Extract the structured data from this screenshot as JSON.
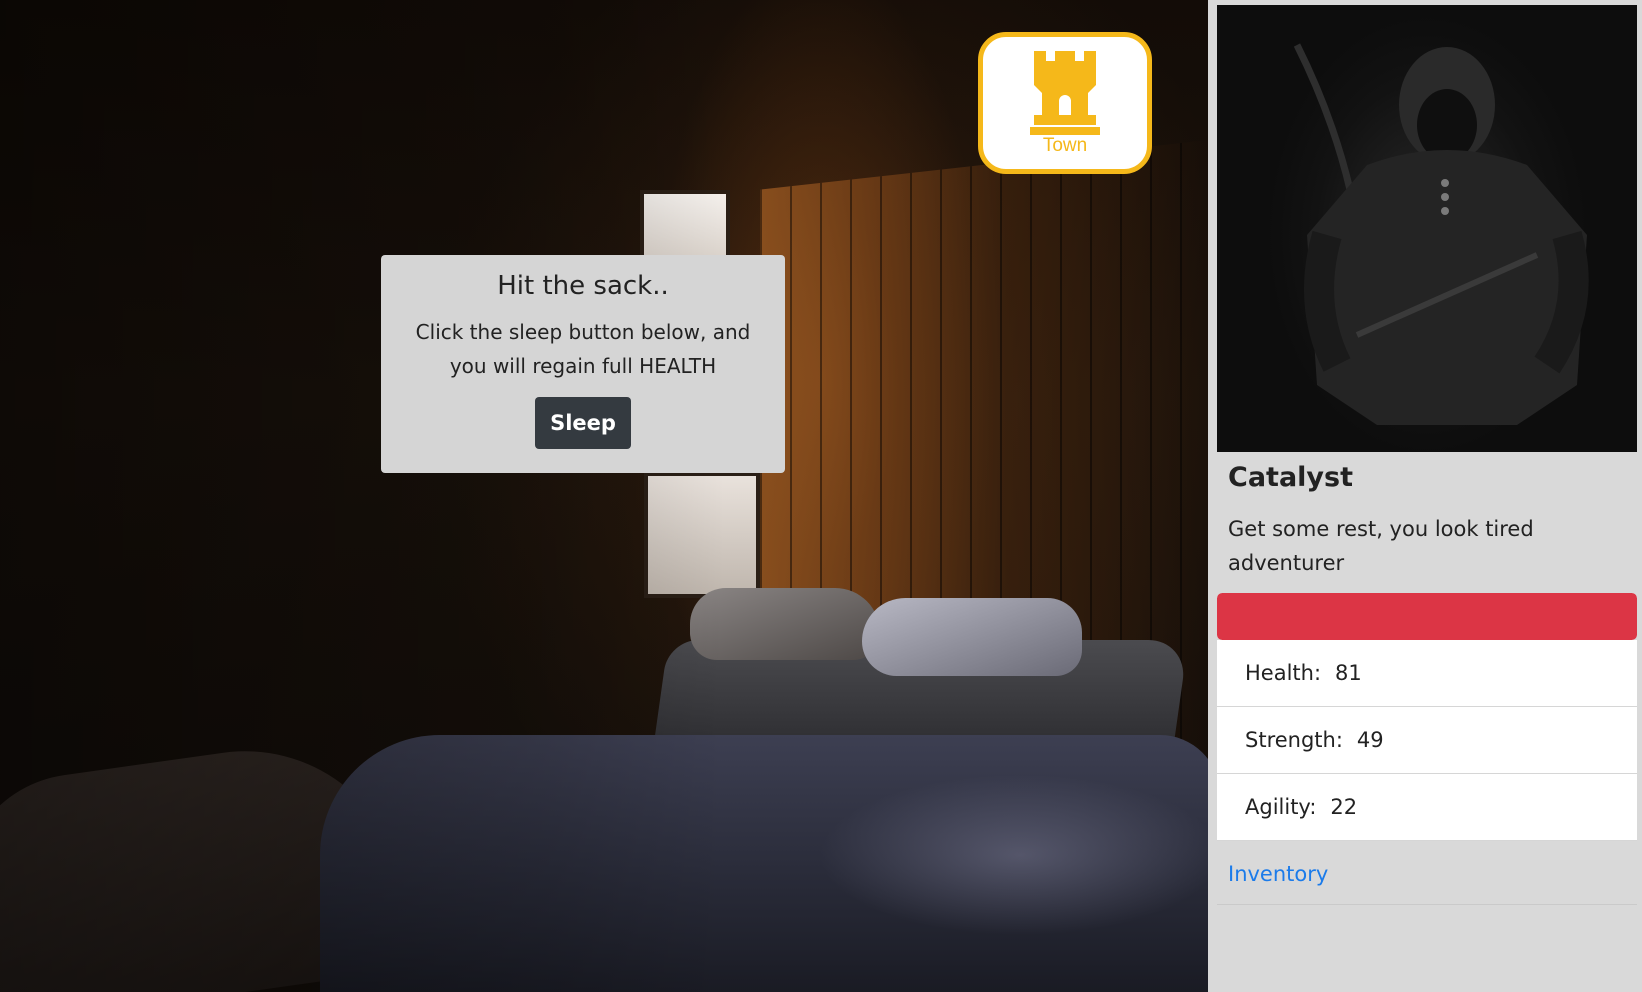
{
  "nav": {
    "town_label": "Town"
  },
  "dialog": {
    "title": "Hit the sack..",
    "body": "Click the sleep button below, and you will regain full HEALTH",
    "sleep_label": "Sleep"
  },
  "character": {
    "name": "Catalyst",
    "description": "Get some rest, you look tired adventurer",
    "health_fraction": 1.0,
    "stats": [
      {
        "label": "Health:",
        "value": "81"
      },
      {
        "label": "Strength:",
        "value": "49"
      },
      {
        "label": "Agility:",
        "value": "22"
      }
    ],
    "inventory_label": "Inventory"
  },
  "colors": {
    "accent_gold": "#f5b81a",
    "health_red": "#dc3545",
    "link_blue": "#1b7bea",
    "button_dark": "#343a40"
  }
}
